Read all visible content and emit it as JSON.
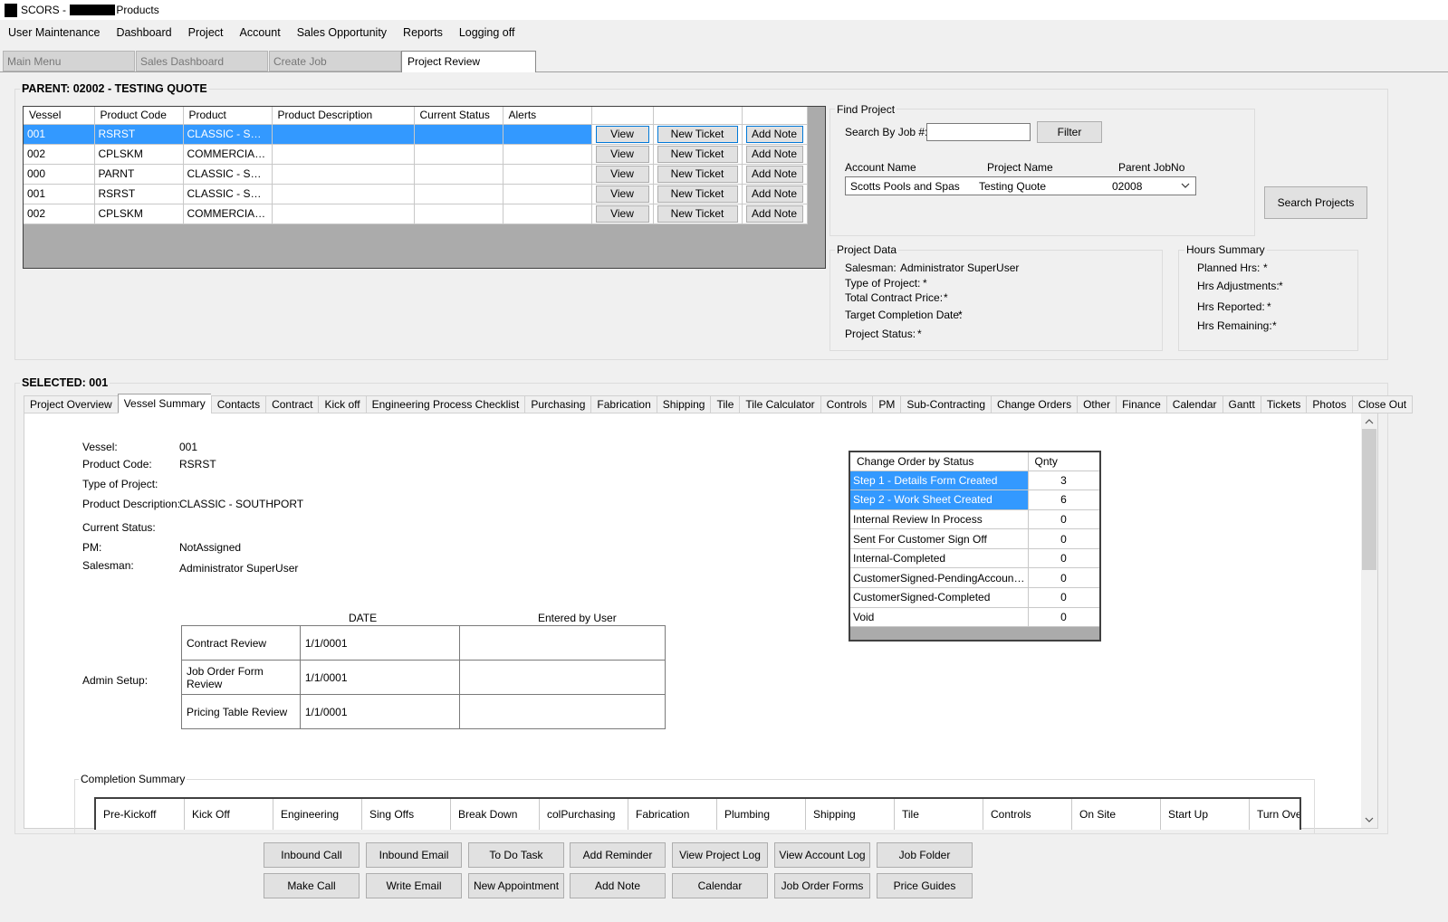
{
  "window": {
    "title_prefix": "SCORS - ",
    "title_suffix": "Products"
  },
  "menu": [
    "User Maintenance",
    "Dashboard",
    "Project",
    "Account",
    "Sales Opportunity",
    "Reports",
    "Logging off"
  ],
  "top_tabs": [
    {
      "label": "Main Menu",
      "active": false
    },
    {
      "label": "Sales Dashboard",
      "active": false
    },
    {
      "label": "Create Job",
      "active": false
    },
    {
      "label": "Project Review",
      "active": true
    }
  ],
  "parent": {
    "title": "PARENT: 02002 - TESTING QUOTE",
    "columns": [
      "Vessel",
      "Product Code",
      "Product",
      "Product Description",
      "Current Status",
      "Alerts"
    ],
    "row_buttons": {
      "view": "View",
      "new_ticket": "New Ticket",
      "add_note": "Add Note"
    },
    "rows": [
      {
        "vessel": "001",
        "code": "RSRST",
        "product": "CLASSIC - SOUTHPORT",
        "desc": "",
        "status": "",
        "alerts": ""
      },
      {
        "vessel": "002",
        "code": "CPLSKM",
        "product": "COMMERCIAL POOL",
        "desc": "",
        "status": "",
        "alerts": ""
      },
      {
        "vessel": "000",
        "code": "PARNT",
        "product": "CLASSIC - SOUTHPORT",
        "desc": "",
        "status": "",
        "alerts": ""
      },
      {
        "vessel": "001",
        "code": "RSRST",
        "product": "CLASSIC - SOUTHPORT",
        "desc": "",
        "status": "",
        "alerts": ""
      },
      {
        "vessel": "002",
        "code": "CPLSKM",
        "product": "COMMERCIAL POOL",
        "desc": "",
        "status": "",
        "alerts": ""
      }
    ]
  },
  "find_project": {
    "title": "Find Project",
    "search_label": "Search By Job #:",
    "search_value": "",
    "filter_button": "Filter",
    "col_account": "Account Name",
    "col_project": "Project Name",
    "col_parent": "Parent JobNo",
    "selected_account": "Scotts Pools and Spas",
    "selected_project": "Testing Quote",
    "selected_parent": "02008",
    "search_projects_button": "Search Projects"
  },
  "project_data": {
    "title": "Project Data",
    "salesman_label": "Salesman:",
    "salesman_value": "Administrator SuperUser",
    "type_label": "Type of Project:",
    "type_value": "*",
    "price_label": "Total Contract Price:",
    "price_value": "*",
    "target_label": "Target Completion Date:",
    "target_value": "*",
    "status_label": "Project Status:",
    "status_value": "*"
  },
  "hours_summary": {
    "title": "Hours Summary",
    "planned_label": "Planned Hrs:",
    "planned_value": "*",
    "adj_label": "Hrs Adjustments:",
    "adj_value": "*",
    "reported_label": "Hrs Reported:",
    "reported_value": "*",
    "remaining_label": "Hrs Remaining:",
    "remaining_value": "*"
  },
  "selected": {
    "title": "SELECTED: 001",
    "tabs": [
      "Project Overview",
      "Vessel Summary",
      "Contacts",
      "Contract",
      "Kick off",
      "Engineering Process Checklist",
      "Purchasing",
      "Fabrication",
      "Shipping",
      "Tile",
      "Tile Calculator",
      "Controls",
      "PM",
      "Sub-Contracting",
      "Change Orders",
      "Other",
      "Finance",
      "Calendar",
      "Gantt",
      "Tickets",
      "Photos",
      "Close Out"
    ],
    "active_tab": "Vessel Summary"
  },
  "vessel_summary": {
    "vessel_label": "Vessel:",
    "vessel_value": "001",
    "code_label": "Product Code:",
    "code_value": "RSRST",
    "type_label": "Type of Project:",
    "type_value": "",
    "desc_label": "Product Description:",
    "desc_value": "CLASSIC - SOUTHPORT",
    "status_label": "Current Status:",
    "status_value": "",
    "pm_label": "PM:",
    "pm_value": "NotAssigned",
    "salesman_label": "Salesman:",
    "salesman_value": "Administrator SuperUser"
  },
  "admin_setup": {
    "label": "Admin Setup:",
    "col_date": "DATE",
    "col_user": "Entered by User",
    "rows": [
      {
        "item": "Contract  Review",
        "date": "1/1/0001",
        "user": ""
      },
      {
        "item": "Job Order Form Review",
        "date": "1/1/0001",
        "user": ""
      },
      {
        "item": "Pricing Table Review",
        "date": "1/1/0001",
        "user": ""
      }
    ]
  },
  "change_orders": {
    "col_status": "Change Order by Status",
    "col_qty": "Qnty",
    "rows": [
      {
        "status": "Step 1 - Details Form Created",
        "qty": "3"
      },
      {
        "status": "Step 2 - Work Sheet Created",
        "qty": "6"
      },
      {
        "status": "Internal Review In Process",
        "qty": "0"
      },
      {
        "status": "Sent For Customer Sign Off",
        "qty": "0"
      },
      {
        "status": "Internal-Completed",
        "qty": "0"
      },
      {
        "status": "CustomerSigned-PendingAccountApproval",
        "qty": "0"
      },
      {
        "status": "CustomerSigned-Completed",
        "qty": "0"
      },
      {
        "status": "Void",
        "qty": "0"
      }
    ]
  },
  "completion_summary": {
    "title": "Completion Summary",
    "columns": [
      "Pre-Kickoff",
      "Kick Off",
      "Engineering",
      "Sing Offs",
      "Break Down",
      "colPurchasing",
      "Fabrication",
      "Plumbing",
      "Shipping",
      "Tile",
      "Controls",
      "On Site",
      "Start Up",
      "Turn Over"
    ]
  },
  "bottom_buttons": {
    "row1": [
      "Inbound Call",
      "Inbound Email",
      "To Do Task",
      "Add Reminder",
      "View Project Log",
      "View Account Log",
      "Job Folder"
    ],
    "row2": [
      "Make Call",
      "Write Email",
      "New Appointment",
      "Add Note",
      "Calendar",
      "Job Order Forms",
      "Price Guides"
    ]
  }
}
